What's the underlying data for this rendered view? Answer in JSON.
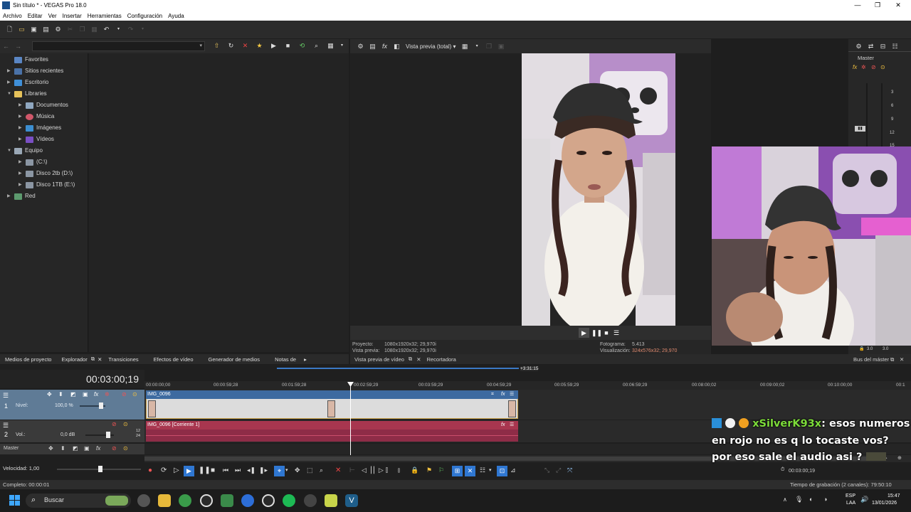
{
  "window": {
    "title": "Sin título * - VEGAS Pro 18.0"
  },
  "menu": [
    "Archivo",
    "Editar",
    "Ver",
    "Insertar",
    "Herramientas",
    "Configuración",
    "Ayuda"
  ],
  "explorer": {
    "tree": [
      {
        "label": "Favorites"
      },
      {
        "label": "Sitios recientes"
      },
      {
        "label": "Escritorio"
      },
      {
        "label": "Libraries"
      },
      {
        "label": "Documentos"
      },
      {
        "label": "Música"
      },
      {
        "label": "Imágenes"
      },
      {
        "label": "Vídeos"
      },
      {
        "label": "Equipo"
      },
      {
        "label": "(C:\\)"
      },
      {
        "label": "Disco 2tb (D:\\)"
      },
      {
        "label": "Disco 1TB (E:\\)"
      },
      {
        "label": "Red"
      }
    ]
  },
  "preview": {
    "mode": "Vista previa (total)",
    "proyecto_label": "Proyecto:",
    "proyecto_value": "1080x1920x32; 29,970i",
    "vista_label": "Vista previa:",
    "vista_value": "1080x1920x32; 29,970i",
    "fotograma_label": "Fotograma:",
    "fotograma_value": "5.413",
    "visualizacion_label": "Visualización:",
    "visualizacion_value": "324x576x32; 29,970"
  },
  "master": {
    "label": "Master",
    "db_ticks": [
      "3",
      "6",
      "9",
      "12",
      "15"
    ],
    "bottom_left": "3.0",
    "bottom_right": "3.0"
  },
  "tabs_left": [
    "Medios de proyecto",
    "Explorador",
    "Transiciones",
    "Efectos de vídeo",
    "Generador de medios",
    "Notas de"
  ],
  "tabs_mid": [
    "Vista previa de vídeo",
    "Recortadora"
  ],
  "tabs_right": "Bus del máster",
  "timeline": {
    "timecode": "00:03:00;19",
    "ruler": [
      "00:00:00;00",
      "00:00:59;28",
      "00:01:59;28",
      "00:02:59;29",
      "00:03:59;29",
      "00:04:59;29",
      "00:05:59;29",
      "00:06:59;29",
      "00:08:00;02",
      "00:09:00;02",
      "00:10:00;00",
      "00:1"
    ],
    "loop_label": "+3:31:15",
    "video_track": {
      "level_label": "Nivel:",
      "level_value": "100,0 %",
      "clip": "IMG_0096"
    },
    "audio_track": {
      "vol_label": "Vol.:",
      "vol_value": "0,0 dB",
      "clip": "IMG_0096 [Corriente 1]",
      "num_top": "12",
      "num_bottom": "24"
    },
    "master_label": "Master",
    "speed_label": "Velocidad: 1,00",
    "end_time": "00:03:00;19"
  },
  "chat": {
    "username": "xSilverK93x",
    "message": ": esos numeros en rojo no es q lo tocaste vos? por eso sale el audio asi ?"
  },
  "status": {
    "left": "Completo: 00:00:01",
    "right": "Tiempo de grabación (2 canales): 79:50:10"
  },
  "taskbar": {
    "search": "Buscar",
    "lang_top": "ESP",
    "lang_bottom": "LAA",
    "time": "15:47",
    "date": "13/01/2026"
  }
}
